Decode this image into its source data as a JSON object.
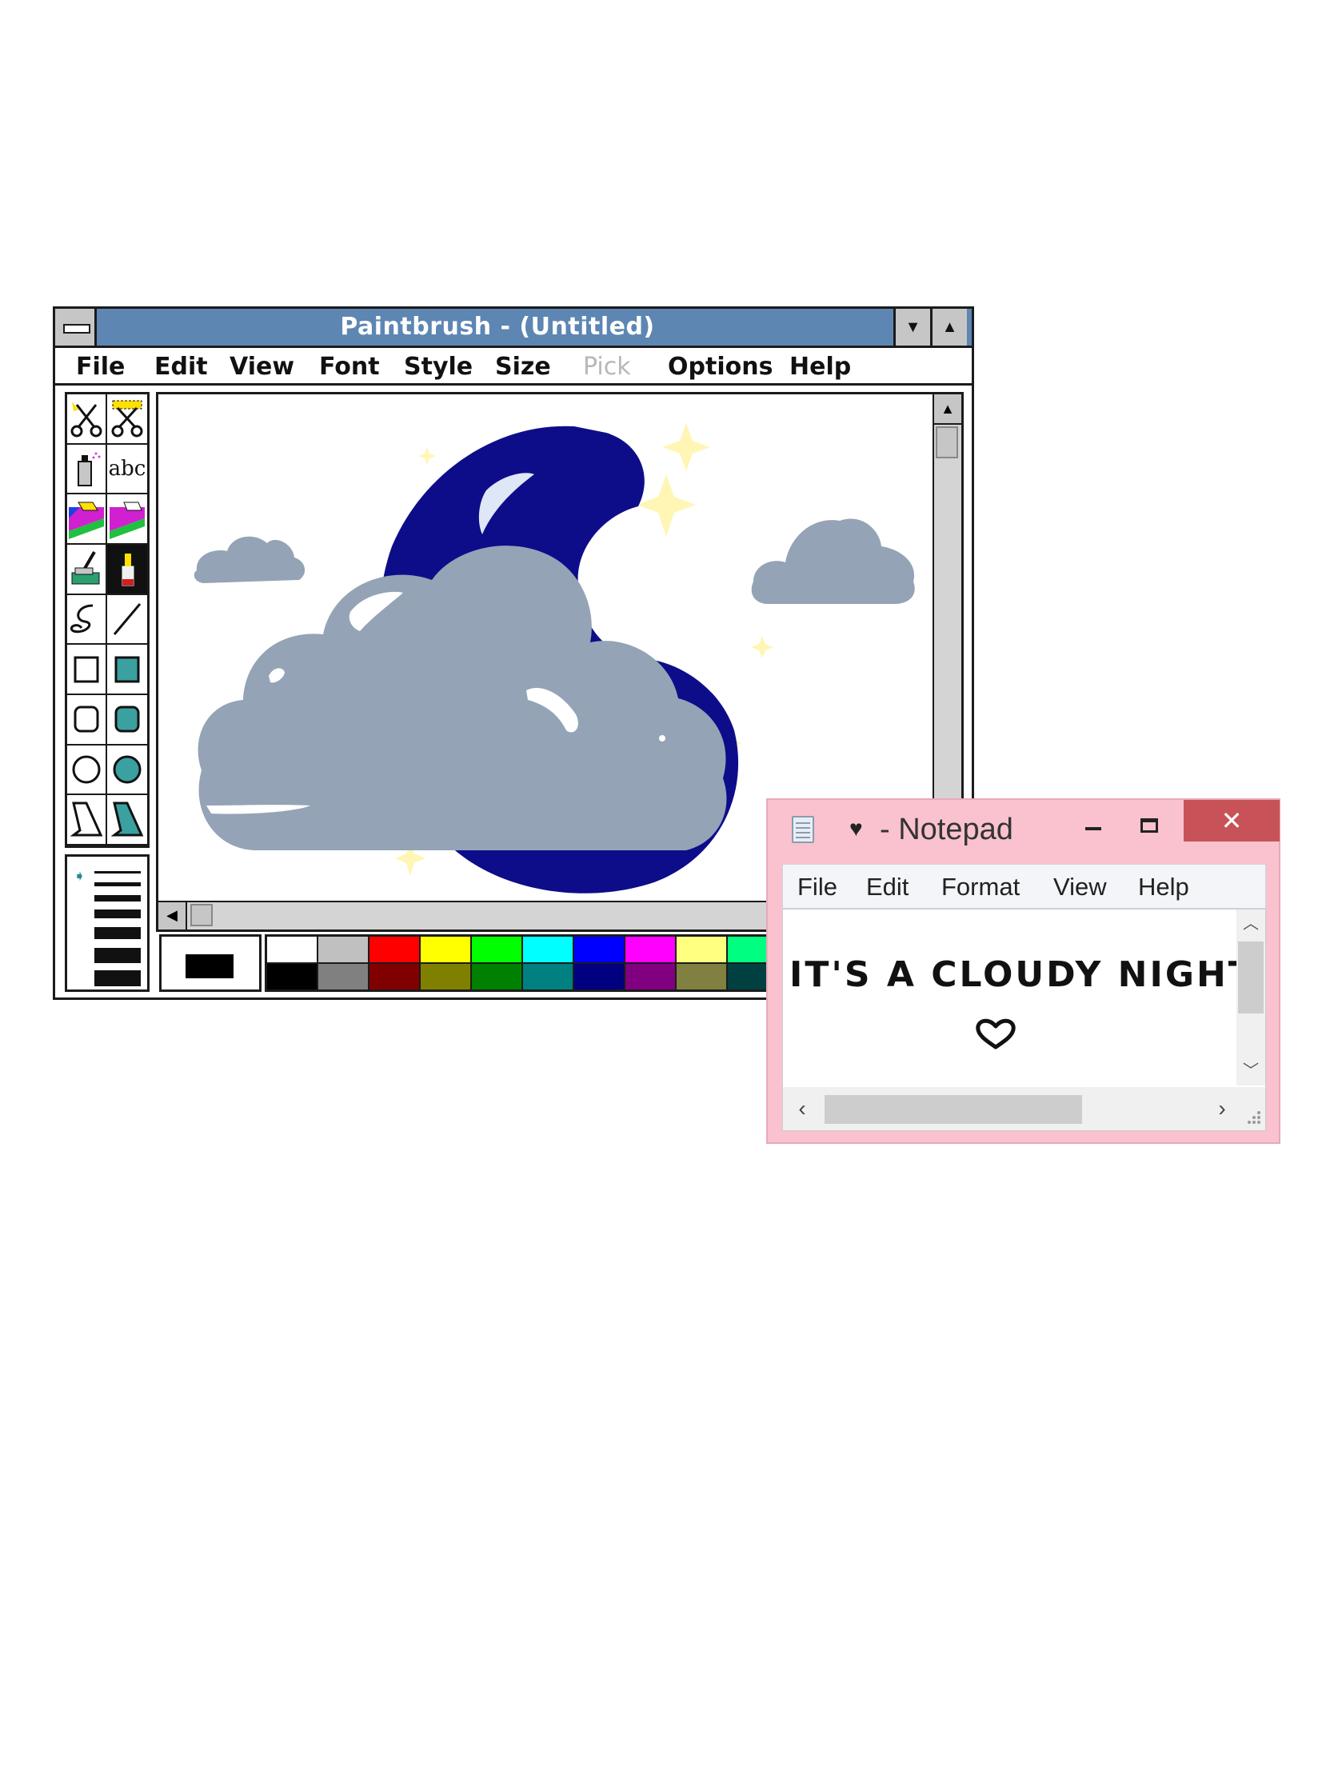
{
  "paintbrush": {
    "title": "Paintbrush - (Untitled)",
    "menus": [
      {
        "label": "File",
        "enabled": true
      },
      {
        "label": "Edit",
        "enabled": true
      },
      {
        "label": "View",
        "enabled": true
      },
      {
        "label": "Font",
        "enabled": true
      },
      {
        "label": "Style",
        "enabled": true
      },
      {
        "label": "Size",
        "enabled": true
      },
      {
        "label": "Pick",
        "enabled": false
      },
      {
        "label": "Options",
        "enabled": true
      },
      {
        "label": "Help",
        "enabled": true
      }
    ],
    "tools": [
      "scissors-icon",
      "pick-scissors-icon",
      "airbrush-icon",
      "text-tool-icon",
      "color-eraser-icon",
      "eraser-icon",
      "paint-roller-icon",
      "brush-icon",
      "curve-icon",
      "line-icon",
      "box-icon",
      "filled-box-icon",
      "rounded-box-icon",
      "filled-rounded-box-icon",
      "circle-icon",
      "filled-circle-icon",
      "polygon-icon",
      "filled-polygon-icon"
    ],
    "text_tool_label": "abc",
    "palette_top": [
      "#ffffff",
      "#c0c0c0",
      "#ff0000",
      "#ffff00",
      "#00ff00",
      "#00ffff",
      "#0000ff",
      "#ff00ff",
      "#ffff80",
      "#00ff80",
      "#80ffff",
      "#8080ff",
      "#ff0080",
      "#ff8040"
    ],
    "palette_bottom": [
      "#000000",
      "#808080",
      "#800000",
      "#808000",
      "#008000",
      "#008080",
      "#000080",
      "#800080",
      "#808040",
      "#004040",
      "#0080ff",
      "#004080",
      "#8000ff",
      "#804000"
    ],
    "foreground_color": "#000000",
    "background_color": "#ffffff",
    "drawing_colors": {
      "moon": "#0d0d8a",
      "cloud": "#94a3b6",
      "stars": "#fff6b5"
    }
  },
  "notepad": {
    "title_heart": "♥",
    "title": "- Notepad",
    "close_glyph": "✕",
    "menus": [
      "File",
      "Edit",
      "Format",
      "View",
      "Help"
    ],
    "text": "IT'S A CLOUDY NIGHT!",
    "frame_color": "#f9c2ce",
    "close_color": "#c75358"
  }
}
